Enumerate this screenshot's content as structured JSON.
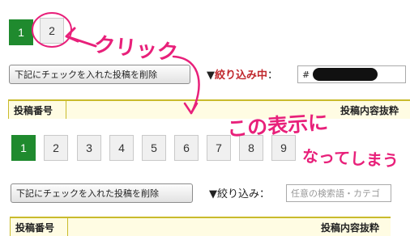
{
  "top": {
    "pagination": [
      "1",
      "2"
    ],
    "active_page": "1",
    "delete_button": "下記にチェックを入れた投稿を削除",
    "filter_prefix": "▼",
    "filter_label": "絞り込み中",
    "filter_colon": "：",
    "filter_value": "#",
    "columns": {
      "number": "投稿番号",
      "content": "投稿内容抜粋"
    }
  },
  "bottom": {
    "pagination": [
      "1",
      "2",
      "3",
      "4",
      "5",
      "6",
      "7",
      "8",
      "9"
    ],
    "active_page": "1",
    "delete_button": "下記にチェックを入れた投稿を削除",
    "filter_prefix": "▼",
    "filter_label": "絞り込み",
    "filter_colon": "：",
    "filter_placeholder": "任意の検索語・カテゴ",
    "columns": {
      "number": "投稿番号",
      "content": "投稿内容抜粋"
    }
  },
  "annotations": {
    "click": "クリック",
    "result_line1": "この表示に",
    "result_line2": "なってしまう"
  },
  "colors": {
    "active_page": "#1f8a2e",
    "annotation": "#e8207a",
    "filter_active": "#c0282d",
    "table_border": "#c9bb2c"
  }
}
